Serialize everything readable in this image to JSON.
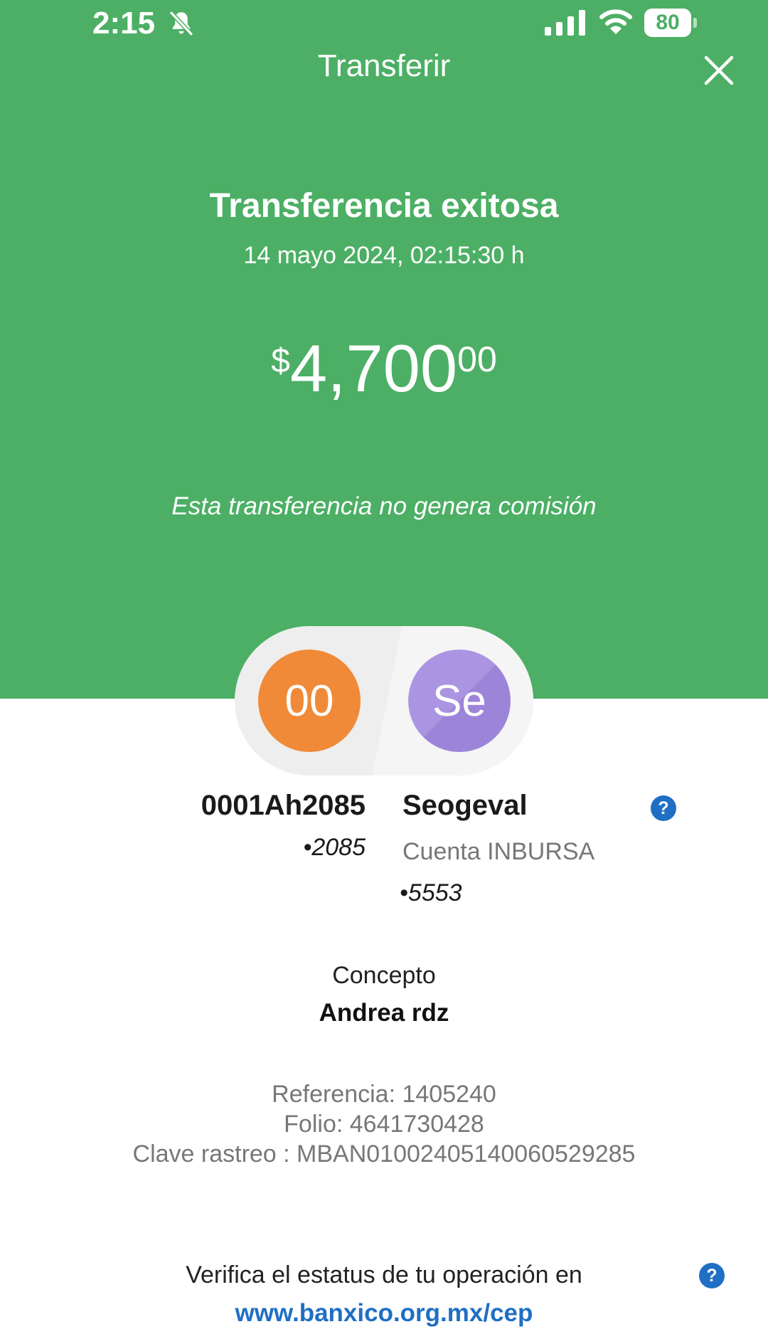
{
  "status_bar": {
    "time": "2:15",
    "battery": "80",
    "icons": [
      "bell-muted-icon",
      "signal-icon",
      "wifi-icon",
      "battery-icon"
    ]
  },
  "nav": {
    "title": "Transferir",
    "close_icon": "close-icon"
  },
  "summary": {
    "title": "Transferencia exitosa",
    "datetime": "14 mayo 2024, 02:15:30 h",
    "amount": {
      "currency": "$",
      "main": "4,700",
      "cents": "00"
    },
    "fee_note": "Esta transferencia no genera comisión"
  },
  "origin": {
    "initials": "00",
    "name": "0001Ah2085",
    "account": "•2085"
  },
  "destination": {
    "initials": "Se",
    "name": "Seogeval",
    "bank": "Cuenta INBURSA",
    "account": "•5553"
  },
  "concept": {
    "label": "Concepto",
    "value": "Andrea rdz"
  },
  "references": {
    "referencia": "Referencia: 1405240",
    "folio": "Folio: 4641730428",
    "clave": "Clave rastreo : MBAN01002405140060529285"
  },
  "verify": {
    "text": "Verifica el estatus de tu operación en",
    "link": "www.banxico.org.mx/cep"
  },
  "colors": {
    "header_green": "#4caf65",
    "origin_avatar": "#f08a38",
    "destination_avatar": "#ab95e3",
    "link_blue": "#1f6fc4"
  }
}
